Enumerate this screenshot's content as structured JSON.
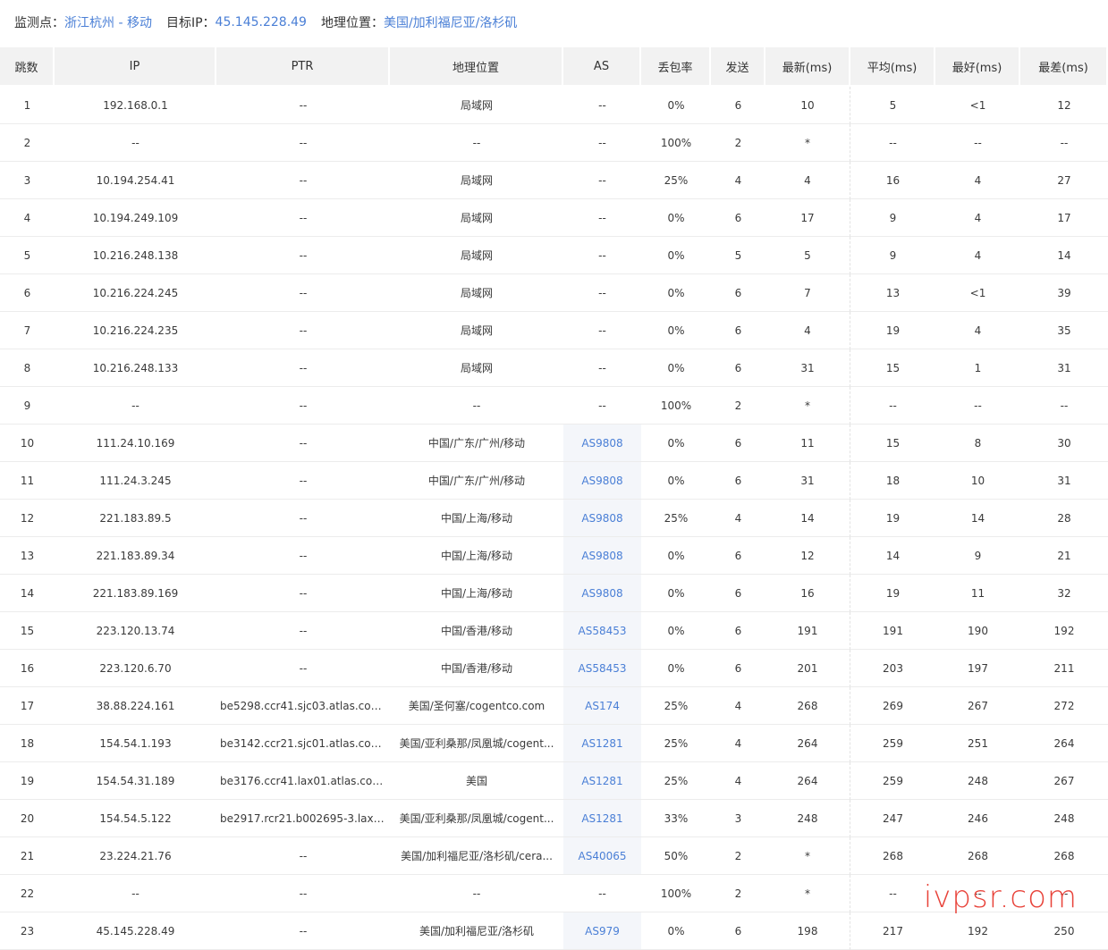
{
  "info": {
    "monitor_label": "监测点：",
    "monitor_value": "浙江杭州 - 移动",
    "target_label": "目标IP：",
    "target_value": "45.145.228.49",
    "geo_label": "地理位置：",
    "geo_value": "美国/加利福尼亚/洛杉矶"
  },
  "columns": [
    "跳数",
    "IP",
    "PTR",
    "地理位置",
    "AS",
    "丢包率",
    "发送",
    "最新(ms)",
    "平均(ms)",
    "最好(ms)",
    "最差(ms)"
  ],
  "rows": [
    {
      "hop": "1",
      "ip": "192.168.0.1",
      "ptr": "--",
      "geo": "局域网",
      "as": "--",
      "loss": "0%",
      "sent": "6",
      "last": "10",
      "avg": "5",
      "best": "<1",
      "worst": "12"
    },
    {
      "hop": "2",
      "ip": "--",
      "ptr": "--",
      "geo": "--",
      "as": "--",
      "loss": "100%",
      "sent": "2",
      "last": "*",
      "avg": "--",
      "best": "--",
      "worst": "--"
    },
    {
      "hop": "3",
      "ip": "10.194.254.41",
      "ptr": "--",
      "geo": "局域网",
      "as": "--",
      "loss": "25%",
      "sent": "4",
      "last": "4",
      "avg": "16",
      "best": "4",
      "worst": "27"
    },
    {
      "hop": "4",
      "ip": "10.194.249.109",
      "ptr": "--",
      "geo": "局域网",
      "as": "--",
      "loss": "0%",
      "sent": "6",
      "last": "17",
      "avg": "9",
      "best": "4",
      "worst": "17"
    },
    {
      "hop": "5",
      "ip": "10.216.248.138",
      "ptr": "--",
      "geo": "局域网",
      "as": "--",
      "loss": "0%",
      "sent": "5",
      "last": "5",
      "avg": "9",
      "best": "4",
      "worst": "14"
    },
    {
      "hop": "6",
      "ip": "10.216.224.245",
      "ptr": "--",
      "geo": "局域网",
      "as": "--",
      "loss": "0%",
      "sent": "6",
      "last": "7",
      "avg": "13",
      "best": "<1",
      "worst": "39"
    },
    {
      "hop": "7",
      "ip": "10.216.224.235",
      "ptr": "--",
      "geo": "局域网",
      "as": "--",
      "loss": "0%",
      "sent": "6",
      "last": "4",
      "avg": "19",
      "best": "4",
      "worst": "35"
    },
    {
      "hop": "8",
      "ip": "10.216.248.133",
      "ptr": "--",
      "geo": "局域网",
      "as": "--",
      "loss": "0%",
      "sent": "6",
      "last": "31",
      "avg": "15",
      "best": "1",
      "worst": "31"
    },
    {
      "hop": "9",
      "ip": "--",
      "ptr": "--",
      "geo": "--",
      "as": "--",
      "loss": "100%",
      "sent": "2",
      "last": "*",
      "avg": "--",
      "best": "--",
      "worst": "--"
    },
    {
      "hop": "10",
      "ip": "111.24.10.169",
      "ptr": "--",
      "geo": "中国/广东/广州/移动",
      "as": "AS9808",
      "loss": "0%",
      "sent": "6",
      "last": "11",
      "avg": "15",
      "best": "8",
      "worst": "30"
    },
    {
      "hop": "11",
      "ip": "111.24.3.245",
      "ptr": "--",
      "geo": "中国/广东/广州/移动",
      "as": "AS9808",
      "loss": "0%",
      "sent": "6",
      "last": "31",
      "avg": "18",
      "best": "10",
      "worst": "31"
    },
    {
      "hop": "12",
      "ip": "221.183.89.5",
      "ptr": "--",
      "geo": "中国/上海/移动",
      "as": "AS9808",
      "loss": "25%",
      "sent": "4",
      "last": "14",
      "avg": "19",
      "best": "14",
      "worst": "28"
    },
    {
      "hop": "13",
      "ip": "221.183.89.34",
      "ptr": "--",
      "geo": "中国/上海/移动",
      "as": "AS9808",
      "loss": "0%",
      "sent": "6",
      "last": "12",
      "avg": "14",
      "best": "9",
      "worst": "21"
    },
    {
      "hop": "14",
      "ip": "221.183.89.169",
      "ptr": "--",
      "geo": "中国/上海/移动",
      "as": "AS9808",
      "loss": "0%",
      "sent": "6",
      "last": "16",
      "avg": "19",
      "best": "11",
      "worst": "32"
    },
    {
      "hop": "15",
      "ip": "223.120.13.74",
      "ptr": "--",
      "geo": "中国/香港/移动",
      "as": "AS58453",
      "loss": "0%",
      "sent": "6",
      "last": "191",
      "avg": "191",
      "best": "190",
      "worst": "192"
    },
    {
      "hop": "16",
      "ip": "223.120.6.70",
      "ptr": "--",
      "geo": "中国/香港/移动",
      "as": "AS58453",
      "loss": "0%",
      "sent": "6",
      "last": "201",
      "avg": "203",
      "best": "197",
      "worst": "211"
    },
    {
      "hop": "17",
      "ip": "38.88.224.161",
      "ptr": "be5298.ccr41.sjc03.atlas.cog...",
      "geo": "美国/圣何塞/cogentco.com",
      "as": "AS174",
      "loss": "25%",
      "sent": "4",
      "last": "268",
      "avg": "269",
      "best": "267",
      "worst": "272"
    },
    {
      "hop": "18",
      "ip": "154.54.1.193",
      "ptr": "be3142.ccr21.sjc01.atlas.cog...",
      "geo": "美国/亚利桑那/凤凰城/cogent...",
      "as": "AS1281",
      "loss": "25%",
      "sent": "4",
      "last": "264",
      "avg": "259",
      "best": "251",
      "worst": "264"
    },
    {
      "hop": "19",
      "ip": "154.54.31.189",
      "ptr": "be3176.ccr41.lax01.atlas.cog...",
      "geo": "美国",
      "as": "AS1281",
      "loss": "25%",
      "sent": "4",
      "last": "264",
      "avg": "259",
      "best": "248",
      "worst": "267"
    },
    {
      "hop": "20",
      "ip": "154.54.5.122",
      "ptr": "be2917.rcr21.b002695-3.lax0...",
      "geo": "美国/亚利桑那/凤凰城/cogent...",
      "as": "AS1281",
      "loss": "33%",
      "sent": "3",
      "last": "248",
      "avg": "247",
      "best": "246",
      "worst": "248"
    },
    {
      "hop": "21",
      "ip": "23.224.21.76",
      "ptr": "--",
      "geo": "美国/加利福尼亚/洛杉矶/cera...",
      "as": "AS40065",
      "loss": "50%",
      "sent": "2",
      "last": "*",
      "avg": "268",
      "best": "268",
      "worst": "268"
    },
    {
      "hop": "22",
      "ip": "--",
      "ptr": "--",
      "geo": "--",
      "as": "--",
      "loss": "100%",
      "sent": "2",
      "last": "*",
      "avg": "--",
      "best": "--",
      "worst": "--"
    },
    {
      "hop": "23",
      "ip": "45.145.228.49",
      "ptr": "--",
      "geo": "美国/加利福尼亚/洛杉矶",
      "as": "AS979",
      "loss": "0%",
      "sent": "6",
      "last": "198",
      "avg": "217",
      "best": "192",
      "worst": "250"
    }
  ],
  "watermark": "ivpsr.com",
  "colors": {
    "link": "#4a7fd6",
    "header_bg": "#f2f2f2",
    "as_bg": "#f4f6fa",
    "watermark": "#e8433a"
  }
}
